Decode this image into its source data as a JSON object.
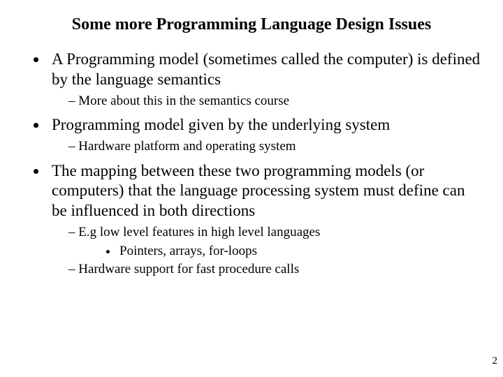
{
  "title": "Some more Programming Language Design Issues",
  "bullets": [
    {
      "text": "A Programming model (sometimes called the computer) is defined by the language semantics",
      "sub": [
        {
          "text": "More about this in the semantics course"
        }
      ]
    },
    {
      "text": "Programming model given by the underlying system",
      "sub": [
        {
          "text": "Hardware platform and operating system"
        }
      ]
    },
    {
      "text": "The mapping between these two programming models (or computers) that the language processing system must define can be influenced in both directions",
      "sub": [
        {
          "text": "E.g low level features in high level languages",
          "sub": [
            {
              "text": "Pointers, arrays, for-loops"
            }
          ]
        },
        {
          "text": "Hardware support for fast procedure calls"
        }
      ]
    }
  ],
  "page_number": "2"
}
